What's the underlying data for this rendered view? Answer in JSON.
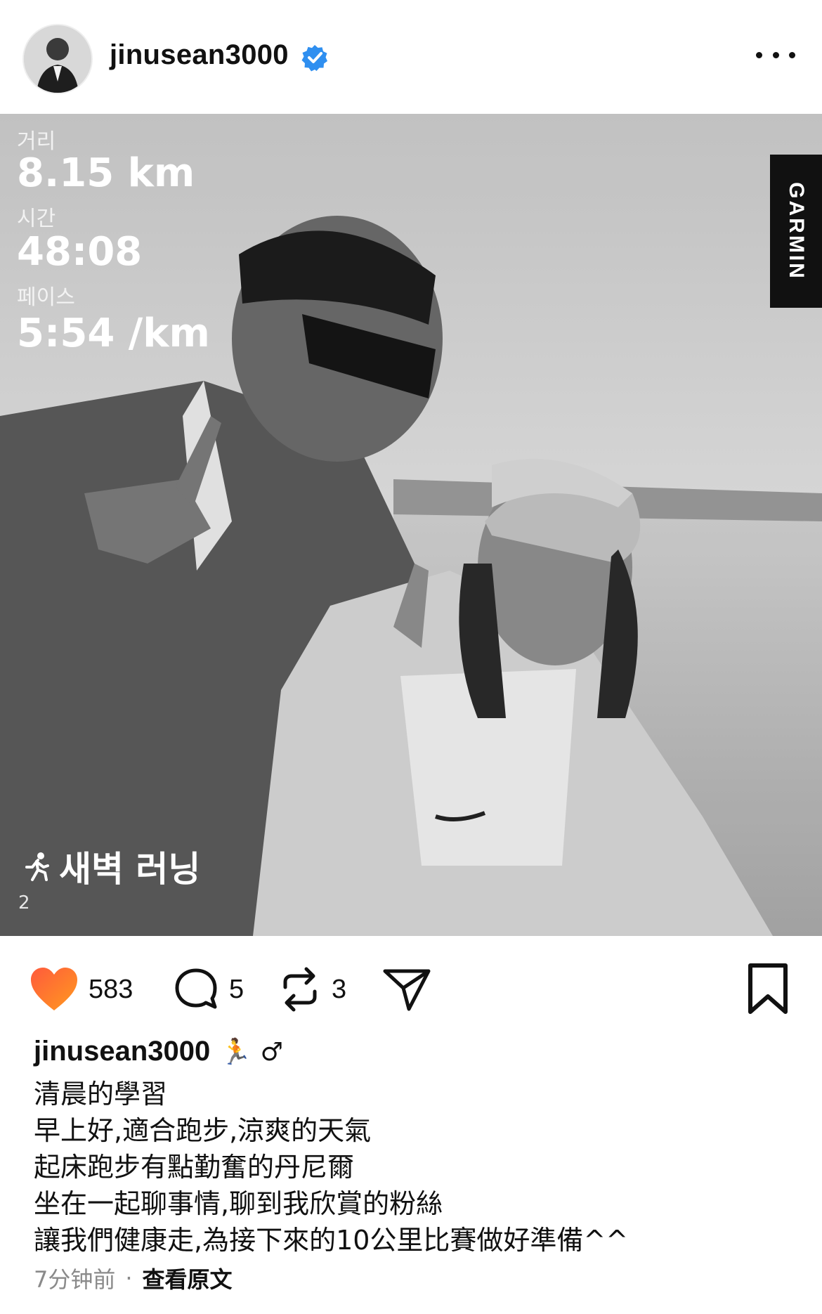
{
  "post": {
    "username": "jinusean3000",
    "verified_icon": "verified-badge-icon",
    "more_icon": "more-horizontal-icon"
  },
  "photo": {
    "stats": [
      {
        "label": "거리",
        "value": "8.15 km"
      },
      {
        "label": "시간",
        "value": "48:08"
      },
      {
        "label": "페이스",
        "value": "5:54 /km"
      }
    ],
    "brand": "GARMIN",
    "activity_icon": "running-person-icon",
    "activity_label": "새벽 러닝",
    "date_partial": "2"
  },
  "actions": {
    "likes": "583",
    "comments": "5",
    "reposts": "3",
    "like_color": "#ff3b30"
  },
  "caption": {
    "username": "jinusean3000",
    "emojis": "🏃 ♂",
    "lines": [
      "清晨的學習",
      "早上好,適合跑步,涼爽的天氣",
      "起床跑步有點勤奮的丹尼爾",
      "坐在一起聊事情,聊到我欣賞的粉絲",
      "讓我們健康走,為接下來的10公里比賽做好準備^^"
    ]
  },
  "footer": {
    "time": "7分钟前",
    "separator": "·",
    "translate_link": "查看原文"
  }
}
